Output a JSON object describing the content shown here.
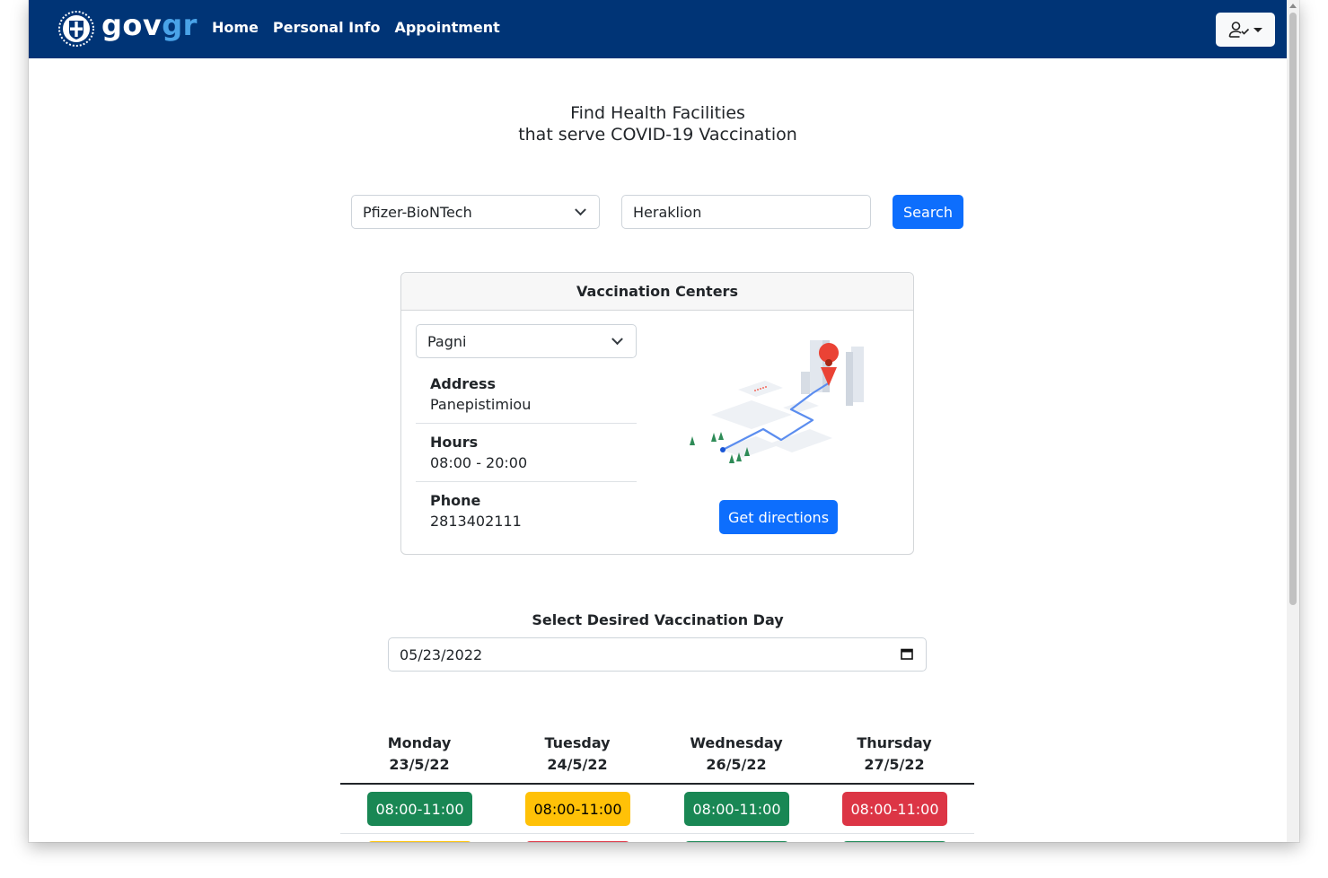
{
  "nav": {
    "brand_gov": "gov",
    "brand_gr": "gr",
    "links": [
      "Home",
      "Personal Info",
      "Appointment"
    ]
  },
  "title_line1": "Find Health Facilities",
  "title_line2": "that serve COVID-19 Vaccination",
  "search": {
    "vaccine_selected": "Pfizer-BioNTech",
    "city_value": "Heraklion",
    "button": "Search"
  },
  "centers": {
    "header": "Vaccination Centers",
    "selected": "Pagni",
    "address_label": "Address",
    "address_value": "Panepistimiou",
    "hours_label": "Hours",
    "hours_value": "08:00 - 20:00",
    "phone_label": "Phone",
    "phone_value": "2813402111",
    "directions_button": "Get directions"
  },
  "day_select": {
    "label": "Select Desired Vaccination Day",
    "value": "05/23/2022"
  },
  "schedule": {
    "columns": [
      {
        "day": "Monday",
        "date": "23/5/22"
      },
      {
        "day": "Tuesday",
        "date": "24/5/22"
      },
      {
        "day": "Wednesday",
        "date": "26/5/22"
      },
      {
        "day": "Thursday",
        "date": "27/5/22"
      }
    ],
    "slots": [
      {
        "time": "08:00-11:00",
        "status": "available"
      },
      {
        "time": "08:00-11:00",
        "status": "limited"
      },
      {
        "time": "08:00-11:00",
        "status": "available"
      },
      {
        "time": "08:00-11:00",
        "status": "full"
      }
    ]
  },
  "colors": {
    "navbar": "#003476",
    "primary": "#0d6efd",
    "success": "#198754",
    "warning": "#ffc107",
    "danger": "#dc3545",
    "next_row": [
      "#ffc107",
      "#dc3545",
      "#198754",
      "#198754"
    ]
  },
  "icons": {
    "emblem": "greek-coat-of-arms-icon",
    "user": "user-check-icon",
    "calendar": "calendar-icon",
    "map": "map-route-illustration"
  }
}
